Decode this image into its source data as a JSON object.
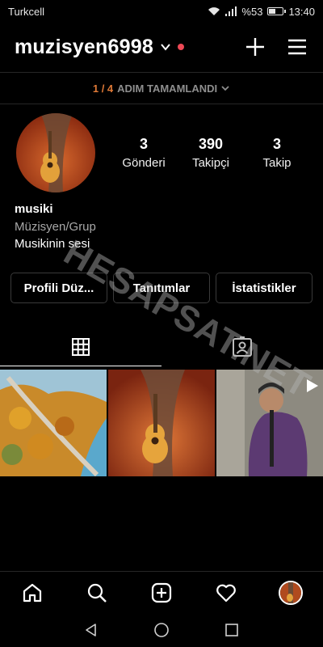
{
  "status_bar": {
    "carrier": "Turkcell",
    "battery": "%53",
    "battery_level": 0.53,
    "time": "13:40"
  },
  "header": {
    "username": "muzisyen6998"
  },
  "steps": {
    "count": "1 / 4",
    "label": "ADIM TAMAMLANDI"
  },
  "stats": [
    {
      "value": "3",
      "label": "Gönderi"
    },
    {
      "value": "390",
      "label": "Takipçi"
    },
    {
      "value": "3",
      "label": "Takip"
    }
  ],
  "bio": {
    "name": "musiki",
    "category": "Müzisyen/Grup",
    "text": "Musikinin sesi"
  },
  "buttons": {
    "edit_profile": "Profili Düz...",
    "promotions": "Tanıtımlar",
    "insights": "İstatistikler"
  },
  "watermark": "HESAPSAT.NET",
  "colors": {
    "accent_orange": "#e07a37",
    "notification_red": "#ed4956",
    "background": "#000000"
  }
}
